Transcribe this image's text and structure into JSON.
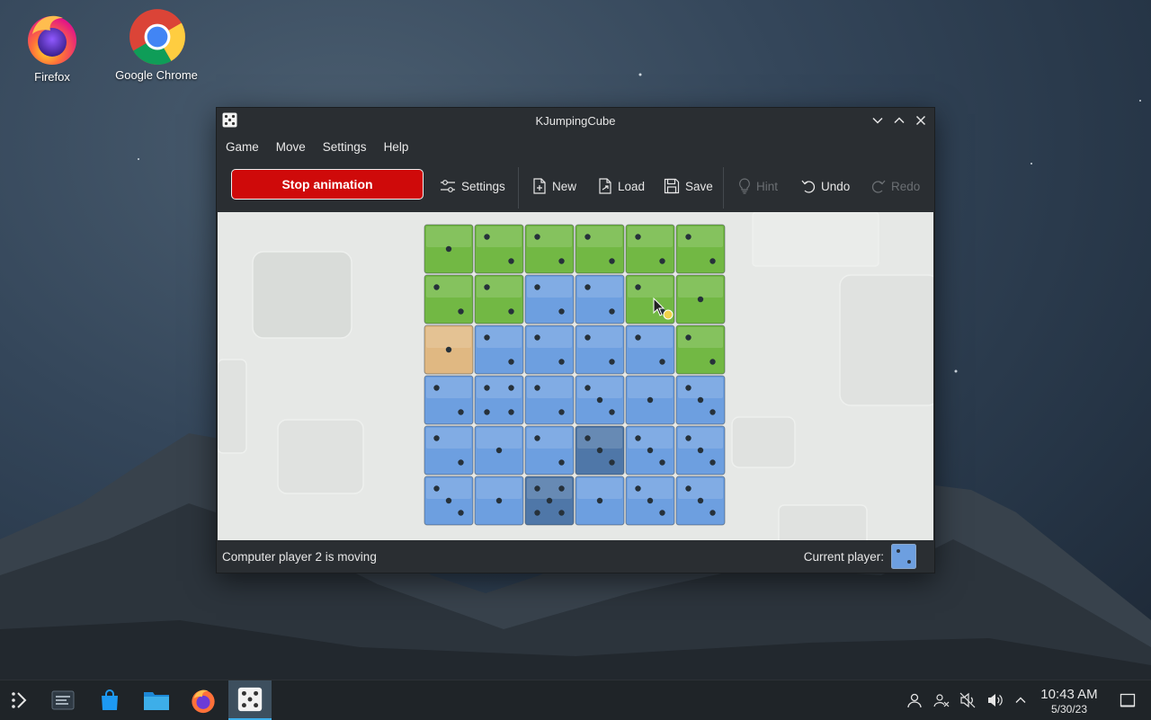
{
  "desktop": {
    "icons": [
      {
        "label": "Firefox"
      },
      {
        "label": "Google Chrome"
      }
    ]
  },
  "window": {
    "title": "KJumpingCube",
    "menu": [
      "Game",
      "Move",
      "Settings",
      "Help"
    ],
    "toolbar": {
      "stop_animation": "Stop animation",
      "settings": "Settings",
      "new": "New",
      "load": "Load",
      "save": "Save",
      "hint": "Hint",
      "undo": "Undo",
      "redo": "Redo"
    },
    "status": {
      "message": "Computer player 2 is moving",
      "current_player_label": "Current player:",
      "current_player": "blue"
    }
  },
  "board": {
    "rows": 6,
    "cols": 6,
    "colors": {
      "green": "#72b844",
      "blue": "#6d9fe0",
      "blue_dark": "#4f77a8",
      "tan": "#e0b882"
    },
    "cells": [
      [
        {
          "o": "green",
          "v": 1
        },
        {
          "o": "green",
          "v": 2
        },
        {
          "o": "green",
          "v": 2
        },
        {
          "o": "green",
          "v": 2
        },
        {
          "o": "green",
          "v": 2
        },
        {
          "o": "green",
          "v": 2
        }
      ],
      [
        {
          "o": "green",
          "v": 2
        },
        {
          "o": "green",
          "v": 2
        },
        {
          "o": "blue",
          "v": 2
        },
        {
          "o": "blue",
          "v": 2
        },
        {
          "o": "green",
          "v": 2
        },
        {
          "o": "green",
          "v": 1
        }
      ],
      [
        {
          "o": "tan",
          "v": 1
        },
        {
          "o": "blue",
          "v": 2
        },
        {
          "o": "blue",
          "v": 2
        },
        {
          "o": "blue",
          "v": 2
        },
        {
          "o": "blue",
          "v": 2
        },
        {
          "o": "green",
          "v": 2
        }
      ],
      [
        {
          "o": "blue",
          "v": 2
        },
        {
          "o": "blue",
          "v": 4
        },
        {
          "o": "blue",
          "v": 2
        },
        {
          "o": "blue",
          "v": 3
        },
        {
          "o": "blue",
          "v": 1
        },
        {
          "o": "blue",
          "v": 3
        }
      ],
      [
        {
          "o": "blue",
          "v": 2
        },
        {
          "o": "blue",
          "v": 1
        },
        {
          "o": "blue",
          "v": 2
        },
        {
          "o": "blue_dark",
          "v": 3
        },
        {
          "o": "blue",
          "v": 3
        },
        {
          "o": "blue",
          "v": 3
        }
      ],
      [
        {
          "o": "blue",
          "v": 3
        },
        {
          "o": "blue",
          "v": 1
        },
        {
          "o": "blue_dark",
          "v": 5
        },
        {
          "o": "blue",
          "v": 1
        },
        {
          "o": "blue",
          "v": 3
        },
        {
          "o": "blue",
          "v": 3
        }
      ]
    ]
  },
  "taskbar": {
    "clock_time": "10:43 AM",
    "clock_date": "5/30/23",
    "tasks": [
      "app-launcher-icon",
      "overview-icon",
      "discover-store-icon",
      "files-folder-icon",
      "firefox-icon",
      "kjumpingcube-icon"
    ],
    "tray": [
      "user-icon",
      "network-icon",
      "volume-muted-icon",
      "volume-icon",
      "tray-expand-icon",
      "show-desktop-icon"
    ]
  }
}
